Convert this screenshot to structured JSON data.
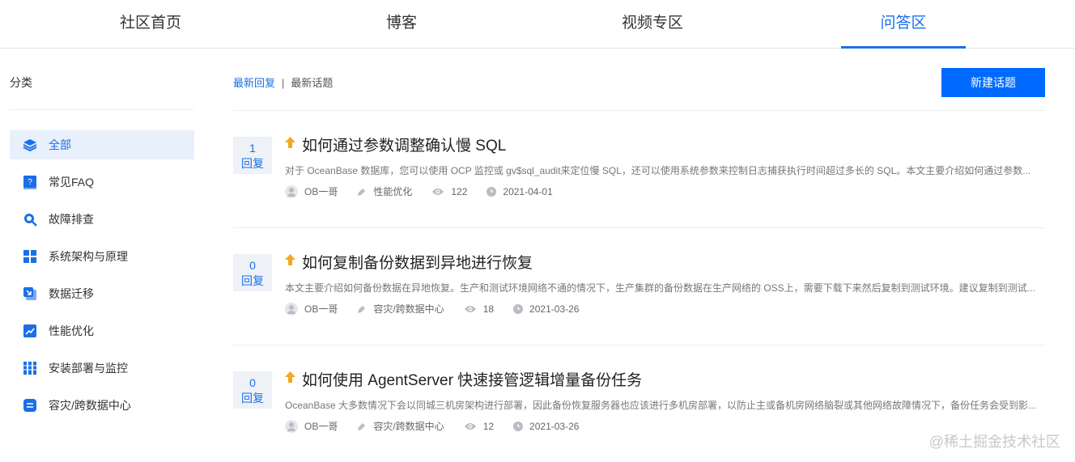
{
  "nav": {
    "tabs": [
      {
        "label": "社区首页"
      },
      {
        "label": "博客"
      },
      {
        "label": "视频专区"
      },
      {
        "label": "问答区"
      }
    ]
  },
  "sidebar": {
    "title": "分类",
    "items": [
      {
        "label": "全部",
        "icon": "layers-icon"
      },
      {
        "label": "常见FAQ",
        "icon": "faq-book-icon"
      },
      {
        "label": "故障排查",
        "icon": "search-icon"
      },
      {
        "label": "系统架构与原理",
        "icon": "grid-icon"
      },
      {
        "label": "数据迁移",
        "icon": "migrate-icon"
      },
      {
        "label": "性能优化",
        "icon": "trend-icon"
      },
      {
        "label": "安装部署与监控",
        "icon": "server-icon"
      },
      {
        "label": "容灾/跨数据中心",
        "icon": "datacenter-icon"
      }
    ]
  },
  "main": {
    "sort_latest_reply": "最新回复",
    "sort_sep": "|",
    "sort_latest_topic": "最新话题",
    "new_topic": "新建话题",
    "posts": [
      {
        "count": "1",
        "count_label": "回复",
        "title": "如何通过参数调整确认慢 SQL",
        "desc": "对于 OceanBase 数据库，您可以使用 OCP 监控或 gv$sql_audit来定位慢 SQL，还可以使用系统参数来控制日志捕获执行时间超过多长的 SQL。本文主要介绍如何通过参数...",
        "author": "OB一哥",
        "category": "性能优化",
        "views": "122",
        "date": "2021-04-01"
      },
      {
        "count": "0",
        "count_label": "回复",
        "title": "如何复制备份数据到异地进行恢复",
        "desc": "本文主要介绍如何备份数据在异地恢复。生产和测试环境网络不通的情况下，生产集群的备份数据在生产网络的 OSS上，需要下载下来然后复制到测试环境。建议复制到测试...",
        "author": "OB一哥",
        "category": "容灾/跨数据中心",
        "views": "18",
        "date": "2021-03-26"
      },
      {
        "count": "0",
        "count_label": "回复",
        "title": "如何使用 AgentServer 快速接管逻辑增量备份任务",
        "desc": "OceanBase 大多数情况下会以同城三机房架构进行部署，因此备份恢复服务器也应该进行多机房部署，以防止主或备机房网络脑裂或其他网络故障情况下，备份任务会受到影...",
        "author": "OB一哥",
        "category": "容灾/跨数据中心",
        "views": "12",
        "date": "2021-03-26"
      }
    ]
  },
  "watermark": "@稀土掘金技术社区",
  "colors": {
    "accent": "#1a6fe8",
    "button": "#006aff",
    "arrow": "#f5a623"
  }
}
